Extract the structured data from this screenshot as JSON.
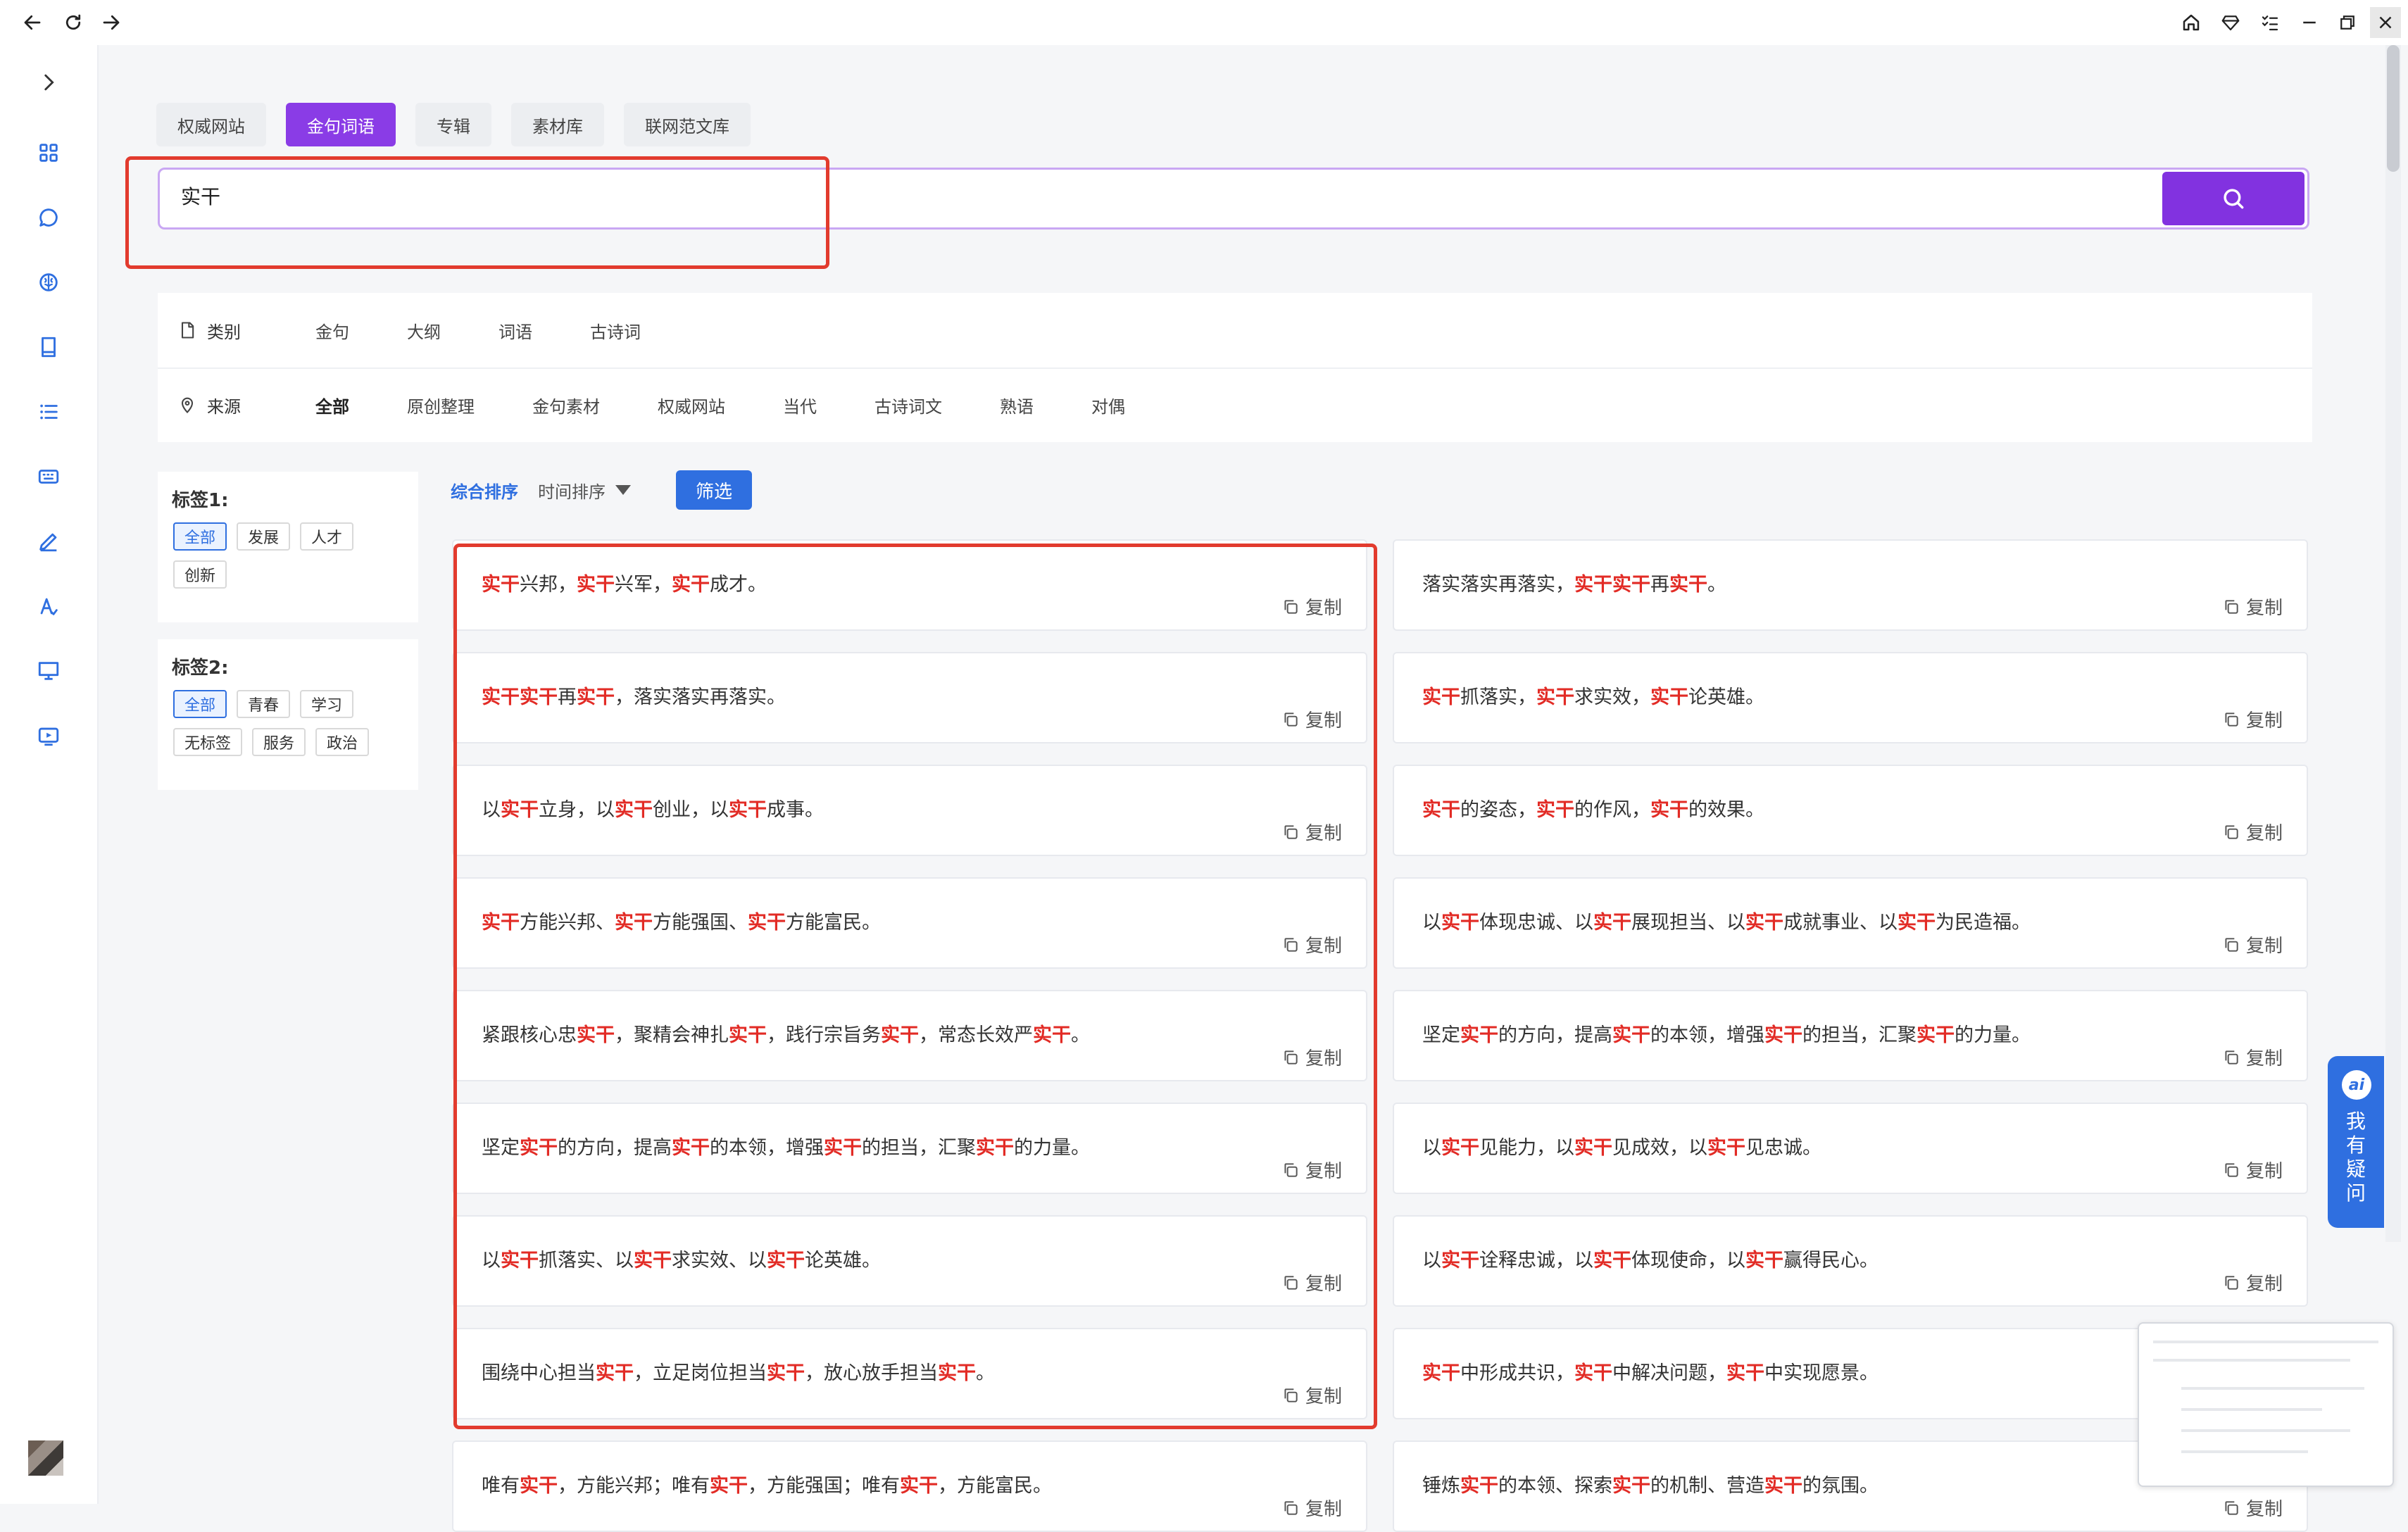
{
  "tabs": [
    "权威网站",
    "金句词语",
    "专辑",
    "素材库",
    "联网范文库"
  ],
  "search": {
    "value": "实干",
    "placeholder": ""
  },
  "filters": {
    "category": {
      "label": "类别",
      "options": [
        "金句",
        "大纲",
        "词语",
        "古诗词"
      ]
    },
    "source": {
      "label": "来源",
      "options": [
        "全部",
        "原创整理",
        "金句素材",
        "权威网站",
        "当代",
        "古诗词文",
        "熟语",
        "对偶"
      ]
    }
  },
  "tag_groups": [
    {
      "title": "标签1:",
      "tags": [
        "全部",
        "发展",
        "人才",
        "创新"
      ]
    },
    {
      "title": "标签2:",
      "tags": [
        "全部",
        "青春",
        "学习",
        "无标签",
        "服务",
        "政治"
      ]
    }
  ],
  "sort": {
    "primary": "综合排序",
    "secondary": "时间排序",
    "filter_button": "筛选"
  },
  "highlight_term": "实干",
  "copy_label": "复制",
  "results_left": [
    "实干兴邦，实干兴军，实干成才。",
    "实干实干再实干，落实落实再落实。",
    "以实干立身，以实干创业，以实干成事。",
    "实干方能兴邦、实干方能强国、实干方能富民。",
    "紧跟核心忠实干，聚精会神扎实干，践行宗旨务实干，常态长效严实干。",
    "坚定实干的方向，提高实干的本领，增强实干的担当，汇聚实干的力量。",
    "以实干抓落实、以实干求实效、以实干论英雄。",
    "围绕中心担当实干，立足岗位担当实干，放心放手担当实干。",
    "唯有实干，方能兴邦；唯有实干，方能强国；唯有实干，方能富民。"
  ],
  "results_right": [
    "落实落实再落实，实干实干再实干。",
    "实干抓落实，实干求实效，实干论英雄。",
    "实干的姿态，实干的作风，实干的效果。",
    "以实干体现忠诚、以实干展现担当、以实干成就事业、以实干为民造福。",
    "坚定实干的方向，提高实干的本领，增强实干的担当，汇聚实干的力量。",
    "以实干见能力，以实干见成效，以实干见忠诚。",
    "以实干诠释忠诚，以实干体现使命，以实干赢得民心。",
    "实干中形成共识，实干中解决问题，实干中实现愿景。",
    "锤炼实干的本领、探索实干的机制、营造实干的氛围。"
  ],
  "ai_widget": {
    "badge": "ai",
    "text": "我有疑问"
  },
  "colors": {
    "accent_purple": "#8232e0",
    "accent_blue": "#2f6fe0",
    "highlight_red": "#e22b25",
    "annotation_red": "#e23b2e"
  }
}
